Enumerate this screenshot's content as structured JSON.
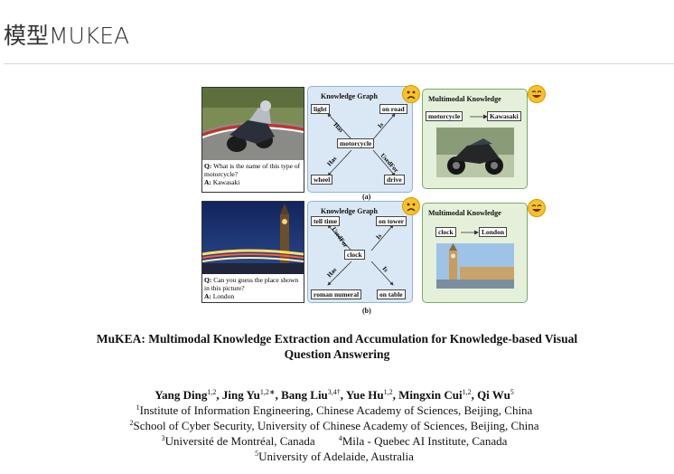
{
  "page": {
    "title": "模型MUKEA"
  },
  "figure": {
    "panel_a": {
      "question_label": "Q:",
      "question": "What is the name of this type of motorcycle?",
      "answer_label": "A:",
      "answer": "Kawasaki",
      "kg_title": "Knowledge Graph",
      "kg_nodes": {
        "center": "motorcycle",
        "top_left": "light",
        "top_right": "on road",
        "bottom_left": "wheel",
        "bottom_right": "drive"
      },
      "kg_edges": {
        "top_left": "Has",
        "top_right": "Is",
        "bottom_left": "Has",
        "bottom_right": "UsedFor"
      },
      "mm_title": "Multimodal Knowledge",
      "mm_head": "motorcycle",
      "mm_tail": "Kawasaki",
      "sub_label": "(a)"
    },
    "panel_b": {
      "question_label": "Q:",
      "question": "Can you guess the place shown in this picture?",
      "answer_label": "A:",
      "answer": "London",
      "kg_title": "Knowledge Graph",
      "kg_nodes": {
        "center": "clock",
        "top_left": "tell time",
        "top_right": "on tower",
        "bottom_left": "roman numeral",
        "bottom_right": "on table"
      },
      "kg_edges": {
        "top_left": "UsedFor",
        "top_right": "Is",
        "bottom_left": "Has",
        "bottom_right": "Is"
      },
      "mm_title": "Multimodal Knowledge",
      "mm_head": "clock",
      "mm_tail": "London",
      "sub_label": "(b)"
    },
    "colors": {
      "kg_bg": "#dae8f5",
      "mm_bg": "#e4f0d9",
      "face": "#f7c22a"
    }
  },
  "paper": {
    "title": "MuKEA: Multimodal Knowledge Extraction and Accumulation for Knowledge-based Visual Question Answering",
    "authors": [
      {
        "name": "Yang Ding",
        "sup": "1,2"
      },
      {
        "name": "Jing Yu",
        "sup": "1,2∗"
      },
      {
        "name": "Bang Liu",
        "sup": "3,4†"
      },
      {
        "name": "Yue Hu",
        "sup": "1,2"
      },
      {
        "name": "Mingxin Cui",
        "sup": "1,2"
      },
      {
        "name": "Qi Wu",
        "sup": "5"
      }
    ],
    "affiliations": [
      {
        "sup": "1",
        "text": "Institute of Information Engineering, Chinese Academy of Sciences, Beijing, China"
      },
      {
        "sup": "2",
        "text": "School of Cyber Security, University of Chinese Academy of Sciences, Beijing, China"
      },
      {
        "sup": "3",
        "text": "Université de Montréal, Canada"
      },
      {
        "sup": "4",
        "text": "Mila - Quebec AI Institute, Canada"
      },
      {
        "sup": "5",
        "text": "University of Adelaide, Australia"
      }
    ]
  }
}
